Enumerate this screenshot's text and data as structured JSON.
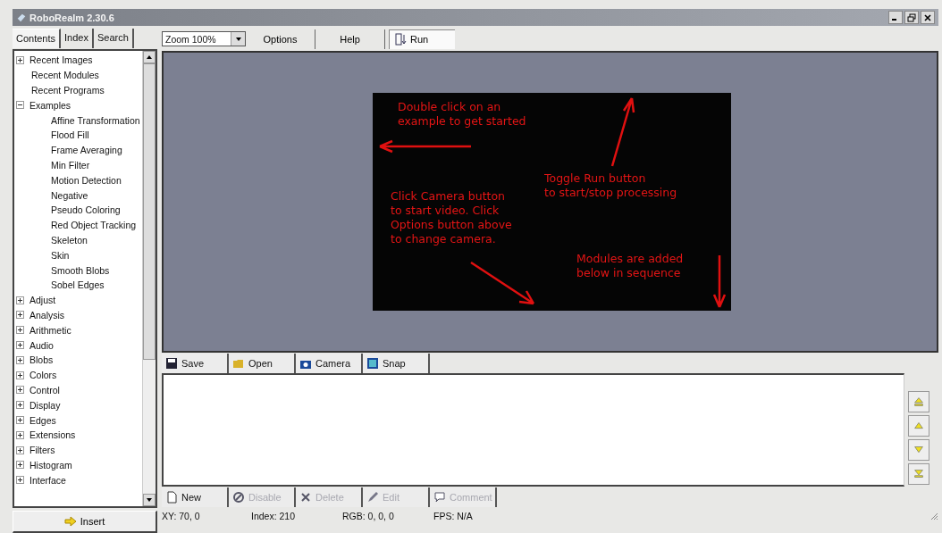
{
  "window": {
    "title": "RoboRealm 2.30.6"
  },
  "help_tabs": [
    {
      "label": "Contents",
      "selected": true
    },
    {
      "label": "Index",
      "selected": false
    },
    {
      "label": "Search",
      "selected": false
    }
  ],
  "tree": [
    {
      "label": "Recent Images",
      "expanded": false
    },
    {
      "label": "Recent Modules"
    },
    {
      "label": "Recent Programs"
    },
    {
      "label": "Examples",
      "expanded": true,
      "children": [
        {
          "label": "Affine Transformation"
        },
        {
          "label": "Flood Fill"
        },
        {
          "label": "Frame Averaging"
        },
        {
          "label": "Min Filter"
        },
        {
          "label": "Motion Detection"
        },
        {
          "label": "Negative"
        },
        {
          "label": "Pseudo Coloring"
        },
        {
          "label": "Red Object Tracking"
        },
        {
          "label": "Skeleton"
        },
        {
          "label": "Skin"
        },
        {
          "label": "Smooth Blobs"
        },
        {
          "label": "Sobel Edges"
        }
      ]
    },
    {
      "label": "Adjust",
      "expanded": false
    },
    {
      "label": "Analysis",
      "expanded": false
    },
    {
      "label": "Arithmetic",
      "expanded": false
    },
    {
      "label": "Audio",
      "expanded": false
    },
    {
      "label": "Blobs",
      "expanded": false
    },
    {
      "label": "Colors",
      "expanded": false
    },
    {
      "label": "Control",
      "expanded": false
    },
    {
      "label": "Display",
      "expanded": false
    },
    {
      "label": "Edges",
      "expanded": false
    },
    {
      "label": "Extensions",
      "expanded": false
    },
    {
      "label": "Filters",
      "expanded": false
    },
    {
      "label": "Histogram",
      "expanded": false
    },
    {
      "label": "Interface",
      "expanded": false
    }
  ],
  "insert_button": {
    "label": "Insert"
  },
  "toolbar": {
    "zoom": {
      "value": "Zoom 100%"
    },
    "buttons": [
      {
        "label": "Options"
      },
      {
        "label": "Help"
      }
    ],
    "run": {
      "label": "Run"
    }
  },
  "canvas_notes": [
    {
      "kind": "left",
      "text": "Double click on an\nexample to get started"
    },
    {
      "kind": "up",
      "text": "Toggle Run button\nto start/stop processing"
    },
    {
      "kind": "diag",
      "text": "Click Camera button\nto start video. Click\nOptions button above\nto change camera."
    },
    {
      "kind": "down",
      "text": "Modules are added\nbelow in sequence"
    }
  ],
  "image_buttons": [
    {
      "kind": "save",
      "label": "Save",
      "disabled": false
    },
    {
      "kind": "open",
      "label": "Open",
      "disabled": false
    },
    {
      "kind": "camera",
      "label": "Camera",
      "disabled": false
    },
    {
      "kind": "snap",
      "label": "Snap",
      "disabled": false
    }
  ],
  "module_buttons": [
    {
      "kind": "new",
      "label": "New",
      "disabled": false
    },
    {
      "kind": "disable",
      "label": "Disable",
      "disabled": true
    },
    {
      "kind": "delete",
      "label": "Delete",
      "disabled": true
    },
    {
      "kind": "edit",
      "label": "Edit",
      "disabled": true
    },
    {
      "kind": "comment",
      "label": "Comment",
      "disabled": true
    }
  ],
  "move_buttons": [
    {
      "kind": "top"
    },
    {
      "kind": "up"
    },
    {
      "kind": "down"
    },
    {
      "kind": "bottom"
    }
  ],
  "status_bar": [
    "XY: 70, 0",
    "Index: 210",
    "RGB: 0, 0, 0",
    "FPS: N/A"
  ]
}
